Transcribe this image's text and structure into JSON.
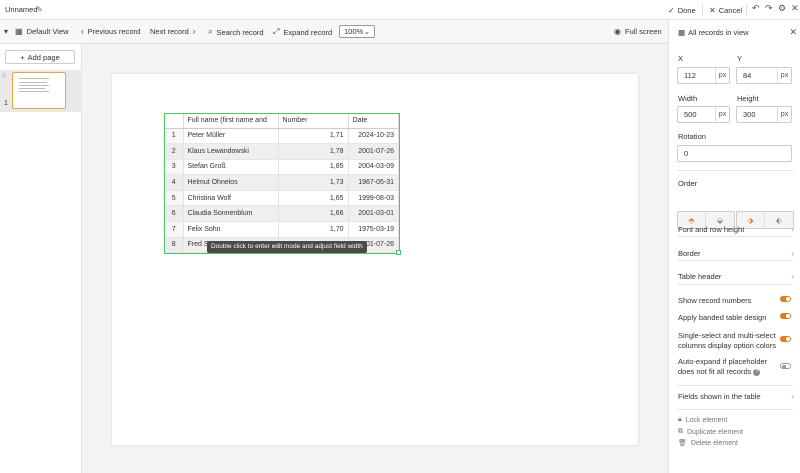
{
  "topbar": {
    "title": "Unnamed",
    "done": "Done",
    "cancel": "Cancel"
  },
  "toolbar": {
    "view": "Default View",
    "previous": "Previous record",
    "next": "Next record",
    "search": "Search record",
    "expand": "Expand record",
    "zoom": "100%",
    "fullscreen": "Full screen"
  },
  "pages": {
    "add_label": "Add page",
    "items": [
      {
        "number": "1"
      }
    ]
  },
  "table": {
    "headers": [
      "Full name (first name and",
      "Number",
      "Date"
    ],
    "rows": [
      {
        "n": "1",
        "name": "Peter Müller",
        "number": "1,71",
        "date": "2024-10-23"
      },
      {
        "n": "2",
        "name": "Klaus Lewandowski",
        "number": "1,78",
        "date": "2001-07-26"
      },
      {
        "n": "3",
        "name": "Stefan Groß",
        "number": "1,85",
        "date": "2004-03-09"
      },
      {
        "n": "4",
        "name": "Helmut Ohnelos",
        "number": "1,73",
        "date": "1967-05-31"
      },
      {
        "n": "5",
        "name": "Christina Wolf",
        "number": "1,65",
        "date": "1999-08-03"
      },
      {
        "n": "6",
        "name": "Claudia Sonnenblum",
        "number": "1,66",
        "date": "2001-03-01"
      },
      {
        "n": "7",
        "name": "Felix Sohn",
        "number": "1,70",
        "date": "1975-03-19"
      },
      {
        "n": "8",
        "name": "Fred S",
        "number": "",
        "date": "2001-07-26"
      }
    ],
    "tooltip": "Double click to enter edit mode and adjust field width"
  },
  "panel": {
    "title": "All records in view",
    "x_label": "X",
    "x_value": "112",
    "x_unit": "px",
    "y_label": "Y",
    "y_value": "84",
    "y_unit": "px",
    "width_label": "Width",
    "width_value": "500",
    "width_unit": "px",
    "height_label": "Height",
    "height_value": "300",
    "height_unit": "px",
    "rotation_label": "Rotation",
    "rotation_value": "0",
    "order_label": "Order",
    "font_row_height": "Font and row height",
    "border": "Border",
    "table_header": "Table header",
    "show_record_numbers": "Show record numbers",
    "banded_design": "Apply banded table design",
    "select_colors": "Single-select and multi-select columns display option colors",
    "auto_expand": "Auto-expand if placeholder does not fit all records",
    "fields_shown": "Fields shown in the table",
    "lock": "Lock element",
    "duplicate": "Duplicate element",
    "delete": "Delete element"
  },
  "colors": {
    "accent": "#e07b1f",
    "selection": "#4cc764"
  }
}
